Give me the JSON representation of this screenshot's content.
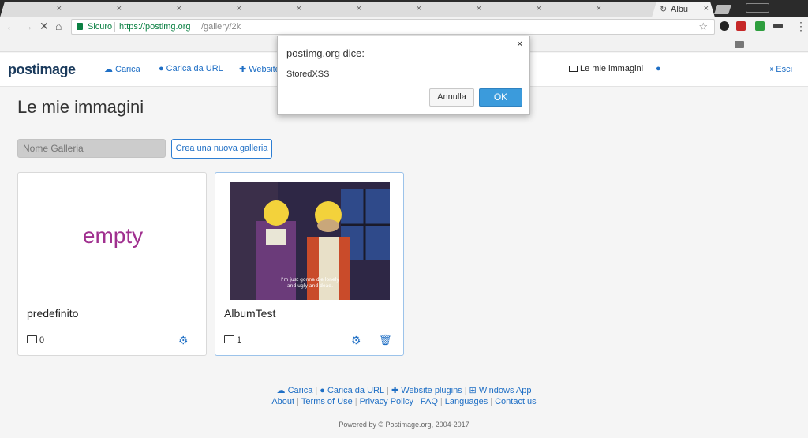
{
  "browser": {
    "active_tab_title": "Albu",
    "secure_label": "Sicuro",
    "url_host": "https://postimg.org",
    "url_path": "/gallery/2k"
  },
  "header": {
    "logo": "postimage",
    "nav": {
      "upload": "Carica",
      "upload_url": "Carica da URL",
      "website": "Website"
    },
    "my_images": "Le mie immagini",
    "logout": "Esci"
  },
  "main": {
    "title": "Le mie immagini",
    "gallery_name_placeholder": "Nome Galleria",
    "new_gallery_button": "Crea una nuova galleria",
    "galleries": [
      {
        "name": "predefinito",
        "count": "0",
        "empty_label": "empty"
      },
      {
        "name": "AlbumTest",
        "count": "1",
        "caption_line1": "I'm just gonna die lonely",
        "caption_line2": "and ugly and dead."
      }
    ]
  },
  "footer": {
    "row1": [
      "Carica",
      "Carica da URL",
      "Website plugins",
      "Windows App"
    ],
    "row2": [
      "About",
      "Terms of Use",
      "Privacy Policy",
      "FAQ",
      "Languages",
      "Contact us"
    ],
    "powered": "Powered by © Postimage.org, 2004-2017"
  },
  "dialog": {
    "title": "postimg.org dice:",
    "message": "StoredXSS",
    "cancel": "Annulla",
    "ok": "OK"
  },
  "colors": {
    "accent": "#1f6fc5",
    "empty_text": "#a0308f",
    "ok_button": "#3b9bdc"
  }
}
